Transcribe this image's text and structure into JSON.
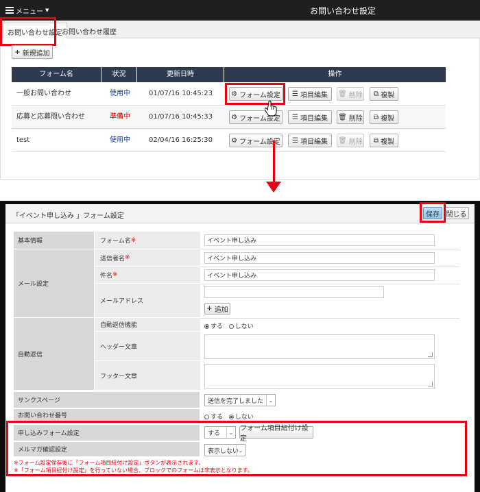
{
  "top": {
    "menu_label": "メニュー",
    "page_title": "お問い合わせ設定",
    "tabs": [
      "お問い合わせ設定",
      "お問い合わせ履歴"
    ],
    "new_button": "新規追加",
    "columns": [
      "フォーム名",
      "状況",
      "更新日時",
      "操作"
    ],
    "actions": {
      "form_settings": "フォーム設定",
      "edit_items": "項目編集",
      "delete": "削除",
      "duplicate": "複製"
    },
    "rows": [
      {
        "name": "一般お問い合わせ",
        "status": "使用中",
        "updated": "01/07/16 10:45:23"
      },
      {
        "name": "応募と応募問い合わせ",
        "status": "準備中",
        "updated": "01/07/16 10:45:33"
      },
      {
        "name": "test",
        "status": "使用中",
        "updated": "02/04/16 16:25:30"
      }
    ]
  },
  "dialog": {
    "title": "「イベント申し込み 」フォーム設定",
    "save": "保存",
    "close": "閉じる",
    "labels": {
      "basic": "基本情報",
      "mail": "メール設定",
      "auto": "自動返信",
      "thanks": "サンクスページ",
      "inquiry_no": "お問い合わせ番号",
      "apply_form": "申し込みフォーム設定",
      "newsletter": "メルマガ確認設定"
    },
    "sub": {
      "form_name": "フォーム名",
      "sender": "送信者名",
      "subject": "件名",
      "mail_address": "メールアドレス",
      "auto_func": "自動返信機能",
      "header": "ヘッダー文章",
      "footer": "フッター文章",
      "req_mark": "※"
    },
    "values": {
      "form_name": "イベント申し込み",
      "sender": "イベント申し込み",
      "subject": "イベント申し込み",
      "add": "追加",
      "yes": "する",
      "no": "しない",
      "thanks_select": "送信を完了しました",
      "apply_select": "する",
      "link_button": "フォーム項目紐付け設定",
      "newsletter_select": "表示しない"
    },
    "notes": [
      "※フォーム設定保存後に「フォーム項目紐付け設定」ボタンが表示されます。",
      "※「フォーム項目紐付け設定」を行っていない場合、ブロックでのフォームは非表示となります。"
    ]
  },
  "colors": {
    "highlight": "#e60012",
    "table_header": "#2e3a50",
    "status_active": "#1a3fa8",
    "status_prep": "#cc0000"
  }
}
